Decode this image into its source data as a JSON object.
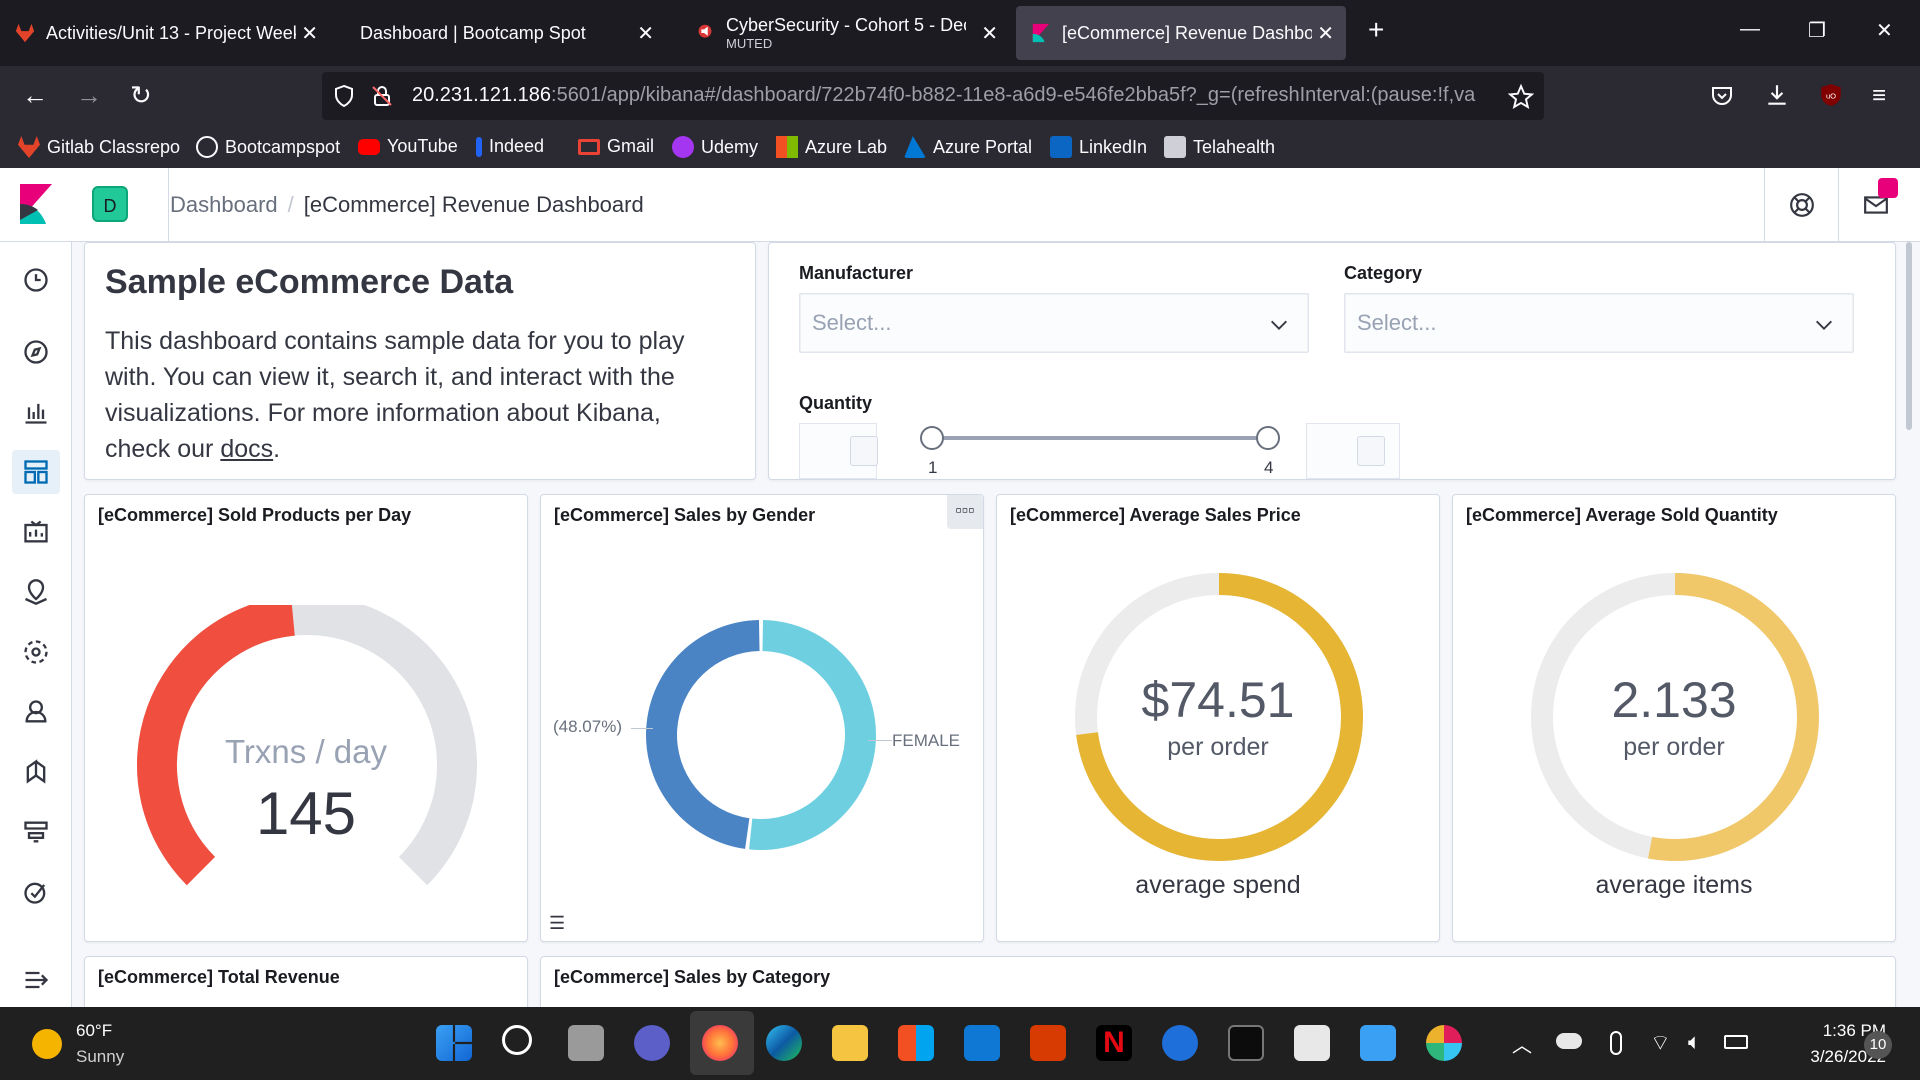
{
  "browser": {
    "tabs": [
      {
        "title": "Activities/Unit 13 - Project Week",
        "active": false
      },
      {
        "title": "Dashboard | Bootcamp Spot",
        "active": false
      },
      {
        "title": "CyberSecurity - Cohort 5 - Dec",
        "subtitle": "MUTED",
        "active": false
      },
      {
        "title": "[eCommerce] Revenue Dashboard",
        "active": true
      }
    ],
    "new_tab_label": "+",
    "url_host": "20.231.121.186",
    "url_rest": ":5601/app/kibana#/dashboard/722b74f0-b882-11e8-a6d9-e546fe2bba5f?_g=(refreshInterval:(pause:!f,va",
    "bookmarks": [
      {
        "label": "Gitlab Classrepo",
        "icon": "gitlab-icon",
        "color": "#e24329"
      },
      {
        "label": "Bootcampspot",
        "icon": "globe-icon",
        "color": "#fbfbfe"
      },
      {
        "label": "YouTube",
        "icon": "youtube-icon",
        "color": "#ff0000"
      },
      {
        "label": "Indeed",
        "icon": "indeed-icon",
        "color": "#2164f3"
      },
      {
        "label": "Gmail",
        "icon": "gmail-icon",
        "color": "#ea4335"
      },
      {
        "label": "Udemy",
        "icon": "udemy-icon",
        "color": "#a435f0"
      },
      {
        "label": "Azure Lab",
        "icon": "microsoft-icon",
        "color": "#00a4ef"
      },
      {
        "label": "Azure Portal",
        "icon": "azure-icon",
        "color": "#0078d4"
      },
      {
        "label": "LinkedIn",
        "icon": "linkedin-icon",
        "color": "#0a66c2"
      },
      {
        "label": "Telahealth",
        "icon": "telahealth-icon",
        "color": "#cfcfd8"
      }
    ]
  },
  "kibana": {
    "space_initial": "D",
    "breadcrumb": {
      "parent": "Dashboard",
      "separator": "/",
      "current": "[eCommerce] Revenue Dashboard"
    }
  },
  "markdown_panel": {
    "title": "Sample eCommerce Data",
    "body": "This dashboard contains sample data for you to play with. You can view it, search it, and interact with the visualizations. For more information about Kibana, check our ",
    "link": "docs",
    "after_link": "."
  },
  "controls": {
    "manufacturer_label": "Manufacturer",
    "manufacturer_placeholder": "Select...",
    "category_label": "Category",
    "category_placeholder": "Select...",
    "quantity_label": "Quantity",
    "quantity_min_tick": "1",
    "quantity_max_tick": "4"
  },
  "panels": {
    "sold_per_day": {
      "title": "[eCommerce] Sold Products per Day",
      "label": "Trxns / day",
      "value": "145",
      "fill_fraction": 0.48,
      "fill_color": "#f04e3e",
      "track_color": "#e0e2e6"
    },
    "sales_by_gender": {
      "title": "[eCommerce] Sales by Gender",
      "left_label": "(48.07%)",
      "right_label": "FEMALE",
      "colors": [
        "#4a84c4",
        "#6dcfe0"
      ]
    },
    "avg_sales_price": {
      "title": "[eCommerce] Average Sales Price",
      "value": "$74.51",
      "sub": "per order",
      "caption": "average spend",
      "fill_fraction": 0.73,
      "fill_color": "#e6b534"
    },
    "avg_sold_quantity": {
      "title": "[eCommerce] Average Sold Quantity",
      "value": "2.133",
      "sub": "per order",
      "caption": "average items",
      "fill_fraction": 0.53,
      "fill_color": "#f0c86a"
    },
    "total_revenue": {
      "title": "[eCommerce] Total Revenue"
    },
    "sales_by_category": {
      "title": "[eCommerce] Sales by Category"
    }
  },
  "taskbar": {
    "weather_temp": "60°F",
    "weather_desc": "Sunny",
    "time": "1:36 PM",
    "date": "3/26/2022",
    "notifications": "10"
  }
}
